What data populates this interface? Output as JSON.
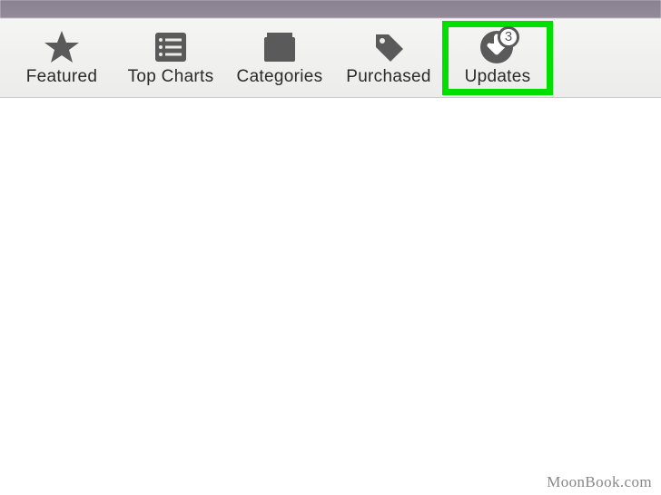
{
  "toolbar": {
    "items": [
      {
        "label": "Featured",
        "icon": "star"
      },
      {
        "label": "Top Charts",
        "icon": "list"
      },
      {
        "label": "Categories",
        "icon": "folder"
      },
      {
        "label": "Purchased",
        "icon": "tag"
      },
      {
        "label": "Updates",
        "icon": "download",
        "badge": "3",
        "highlighted": true
      }
    ]
  },
  "watermark": "MoonBook.com"
}
